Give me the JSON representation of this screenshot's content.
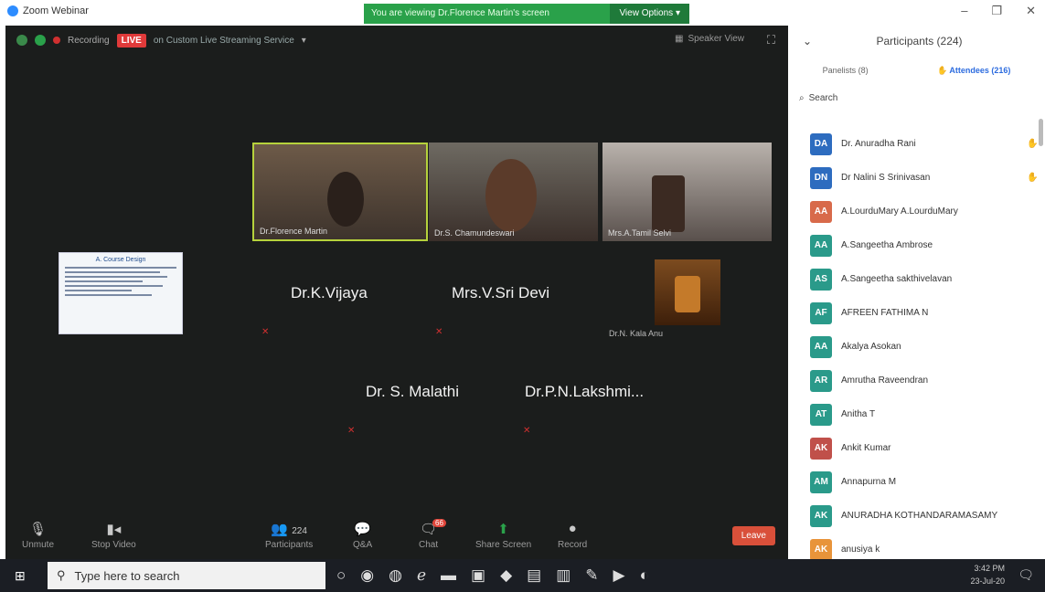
{
  "window": {
    "app_title": "Zoom Webinar",
    "share_banner": "You are viewing Dr.Florence Martin's screen",
    "view_options": "View Options"
  },
  "meeting": {
    "live_label": "LIVE",
    "recording_label": "Recording",
    "stream_label": "on Custom Live Streaming Service",
    "speaker_view": "Speaker View"
  },
  "videos": [
    {
      "name": "Dr.Florence Martin"
    },
    {
      "name": "Dr.S. Chamundeswari"
    },
    {
      "name": "Mrs.A.Tamil Selvi"
    },
    {
      "name": "Dr.N. Kala Anu"
    }
  ],
  "slide": {
    "title": "A. Course Design"
  },
  "name_tiles": [
    "Dr.K.Vijaya",
    "Mrs.V.Sri Devi",
    "Dr. S. Malathi",
    "Dr.P.N.Lakshmi..."
  ],
  "toolbar": {
    "unmute": "Unmute",
    "stop_video": "Stop Video",
    "participants": "Participants",
    "participants_count": "224",
    "qa": "Q&A",
    "chat": "Chat",
    "chat_badge": "66",
    "share_screen": "Share Screen",
    "record": "Record",
    "leave": "Leave"
  },
  "panel": {
    "title": "Participants (224)",
    "panelists_tab": "Panelists (8)",
    "attendees_tab": "Attendees (216)",
    "search_placeholder": "Search",
    "participants": [
      {
        "initials": "DA",
        "name": "Dr. Anuradha Rani",
        "color": "#2d6cbf",
        "hand": true
      },
      {
        "initials": "DN",
        "name": "Dr Nalini S Srinivasan",
        "color": "#2d6cbf",
        "hand": true
      },
      {
        "initials": "AA",
        "name": "A.LourduMary A.LourduMary",
        "color": "#d86a4a",
        "hand": false
      },
      {
        "initials": "AA",
        "name": "A.Sangeetha Ambrose",
        "color": "#2a9a8a",
        "hand": false
      },
      {
        "initials": "AS",
        "name": "A.Sangeetha sakthivelavan",
        "color": "#2a9a8a",
        "hand": false
      },
      {
        "initials": "AF",
        "name": "AFREEN FATHIMA N",
        "color": "#2a9a8a",
        "hand": false
      },
      {
        "initials": "AA",
        "name": "Akalya Asokan",
        "color": "#2a9a8a",
        "hand": false
      },
      {
        "initials": "AR",
        "name": "Amrutha Raveendran",
        "color": "#2a9a8a",
        "hand": false
      },
      {
        "initials": "AT",
        "name": "Anitha T",
        "color": "#2a9a8a",
        "hand": false
      },
      {
        "initials": "AK",
        "name": "Ankit Kumar",
        "color": "#c0504a",
        "hand": false
      },
      {
        "initials": "AM",
        "name": "Annapurna M",
        "color": "#2a9a8a",
        "hand": false
      },
      {
        "initials": "AK",
        "name": "ANURADHA KOTHANDARAMASAMY",
        "color": "#2a9a8a",
        "hand": false
      },
      {
        "initials": "AK",
        "name": "anusiya k",
        "color": "#e8943a",
        "hand": false
      }
    ]
  },
  "taskbar": {
    "search_placeholder": "Type here to search",
    "time": "3:42 PM",
    "date": "23-Jul-20"
  }
}
